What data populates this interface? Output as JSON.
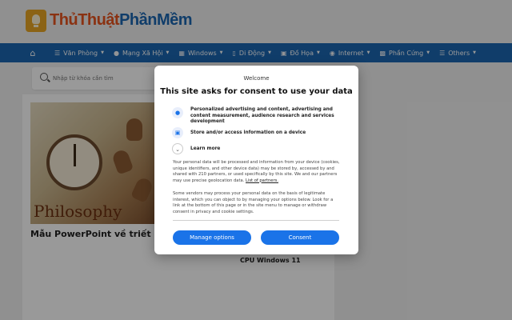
{
  "site": {
    "brand_part1": "ThủThuật",
    "brand_part2": "PhầnMềm"
  },
  "nav": {
    "home_icon": "home-icon",
    "items": [
      {
        "label": "Văn Phòng",
        "icon": "list-icon"
      },
      {
        "label": "Mạng Xã Hội",
        "icon": "users-icon"
      },
      {
        "label": "Windows",
        "icon": "windows-icon"
      },
      {
        "label": "Di Động",
        "icon": "mobile-icon"
      },
      {
        "label": "Đồ Họa",
        "icon": "image-icon"
      },
      {
        "label": "Internet",
        "icon": "globe-icon"
      },
      {
        "label": "Phần Cứng",
        "icon": "monitor-icon"
      },
      {
        "label": "Others",
        "icon": "list-icon"
      }
    ]
  },
  "search": {
    "placeholder": "Nhập từ khóa cần tìm"
  },
  "posts": [
    {
      "title": "Mẫu PowerPoint về triết",
      "image_caption": "Philosophy"
    },
    {
      "title": "CPU Windows 11"
    }
  ],
  "consent": {
    "welcome": "Welcome",
    "title": "This site asks for consent to use your data",
    "purposes": [
      {
        "icon": "person-icon",
        "text": "Personalized advertising and content, advertising and content measurement, audience research and services development"
      },
      {
        "icon": "device-icon",
        "text": "Store and/or access information on a device"
      },
      {
        "icon": "chevron-down-icon",
        "text": "Learn more"
      }
    ],
    "paragraph1": "Your personal data will be processed and information from your device (cookies, unique identifiers, and other device data) may be stored by, accessed by and shared with 210 partners, or used specifically by this site. We and our partners may use precise geolocation data.",
    "partners_link": "List of partners.",
    "paragraph2": "Some vendors may process your personal data on the basis of legitimate interest, which you can object to by managing your options below. Look for a link at the bottom of this page or in the site menu to manage or withdraw consent in privacy and cookie settings.",
    "manage_label": "Manage options",
    "consent_label": "Consent"
  },
  "colors": {
    "nav_blue": "#1b66b1",
    "brand_orange": "#e7541e",
    "button_blue": "#1a73e8"
  }
}
